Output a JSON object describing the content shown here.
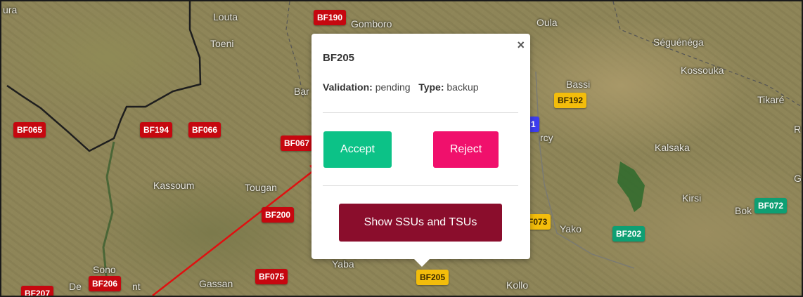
{
  "colors": {
    "marker_red": "#c6070f",
    "marker_yellow": "#f3bd0b",
    "marker_green": "#0e9f73",
    "accept": "#0cc287",
    "reject": "#f0106c",
    "show": "#8a0d2c",
    "arrow": "#e01010"
  },
  "map": {
    "places": [
      "ura",
      "Louta",
      "Toeni",
      "Gomboro",
      "Oula",
      "Séguénéga",
      "Kossouka",
      "Bassi",
      "Tikaré",
      "R",
      "Kalsaka",
      "Bar",
      "Kassoum",
      "Tougan",
      "Kirsi",
      "Bok",
      "G",
      "Yako",
      "Yaba",
      "Sono",
      "De",
      "nt",
      "Gassan",
      "Kollo",
      "rcy",
      "1"
    ],
    "markers": [
      "BF190",
      "BF192",
      "BF065",
      "BF194",
      "BF066",
      "BF067",
      "BF200",
      "F073",
      "BF202",
      "BF072",
      "BF206",
      "BF075",
      "BF205",
      "BF207"
    ]
  },
  "popup": {
    "title": "BF205",
    "close": "×",
    "validation_label": "Validation:",
    "validation_value": "pending",
    "type_label": "Type:",
    "type_value": "backup",
    "accept": "Accept",
    "reject": "Reject",
    "show": "Show SSUs and TSUs"
  }
}
